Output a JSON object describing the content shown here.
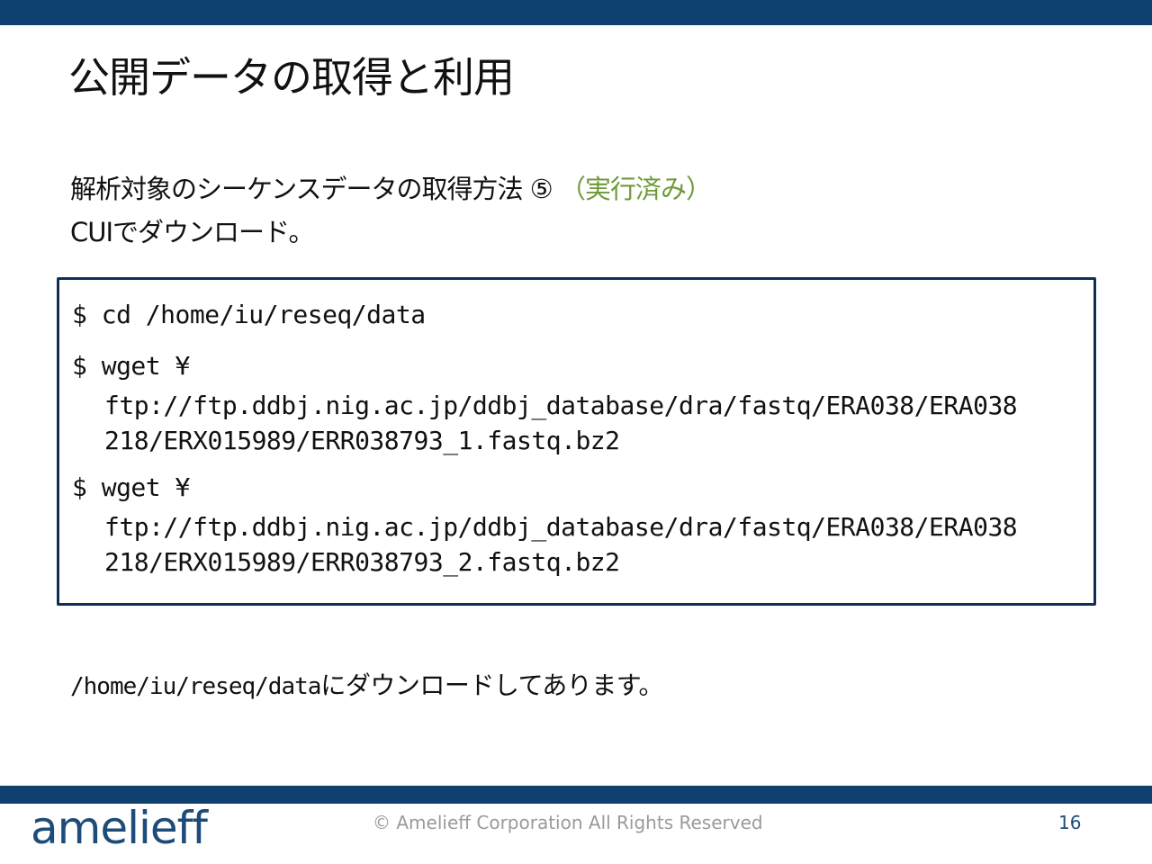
{
  "colors": {
    "bar": "#0f4170",
    "accent_note": "#6f9a3a",
    "code_border": "#0f2f57",
    "logo": "#1d4c79"
  },
  "slide": {
    "title": "公開データの取得と利用",
    "subtitle_main": "解析対象のシーケンスデータの取得方法 ⑤ ",
    "subtitle_note": "（実行済み）",
    "subtitle_line2": "CUIでダウンロード。"
  },
  "code": {
    "line1": "$ cd /home/iu/reseq/data",
    "line2": "$ wget ¥",
    "line3": "ftp://ftp.ddbj.nig.ac.jp/ddbj_database/dra/fastq/ERA038/ERA038",
    "line4": "218/ERX015989/ERR038793_1.fastq.bz2",
    "line5": "$ wget ¥",
    "line6": "ftp://ftp.ddbj.nig.ac.jp/ddbj_database/dra/fastq/ERA038/ERA038",
    "line7": "218/ERX015989/ERR038793_2.fastq.bz2"
  },
  "note": {
    "path": "/home/iu/reseq/data",
    "text": "にダウンロードしてあります。"
  },
  "footer": {
    "logo": "amelieff",
    "copyright": "© Amelieff Corporation All Rights Reserved",
    "page_number": "16"
  }
}
